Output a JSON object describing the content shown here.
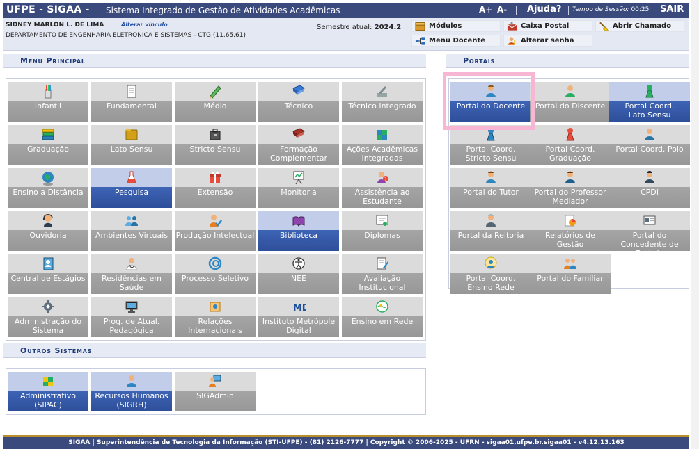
{
  "header": {
    "app_title": "UFPE - SIGAA -",
    "app_subtitle": "Sistema Integrado de Gestão de Atividades Acadêmicas",
    "font_increase": "A+",
    "font_decrease": "A-",
    "help": "Ajuda?",
    "session_label": "Tempo de Sessão:",
    "session_time": "00:25",
    "logout": "SAIR"
  },
  "user": {
    "name": "SIDNEY MARLON L. DE LIMA",
    "change_link": "Alterar vínculo",
    "department": "DEPARTAMENTO DE ENGENHARIA ELETRONICA E SISTEMAS - CTG (11.65.61)",
    "semester_label": "Semestre atual:",
    "semester_value": "2024.2"
  },
  "quick_links": {
    "modulos": "Módulos",
    "caixa_postal": "Caixa Postal",
    "abrir_chamado": "Abrir Chamado",
    "menu_docente": "Menu Docente",
    "alterar_senha": "Alterar senha"
  },
  "sections": {
    "menu_principal": "Menu Principal",
    "portais": "Portais",
    "outros_sistemas": "Outros Sistemas"
  },
  "menu_principal": [
    {
      "label": "Infantil",
      "icon": "pencils-icon",
      "selected": false
    },
    {
      "label": "Fundamental",
      "icon": "notebook-icon",
      "selected": false
    },
    {
      "label": "Médio",
      "icon": "pencil-icon",
      "selected": false
    },
    {
      "label": "Técnico",
      "icon": "blue-book-icon",
      "selected": false
    },
    {
      "label": "Técnico Integrado",
      "icon": "tools-icon",
      "selected": false
    },
    {
      "label": "Graduação",
      "icon": "books-stack-icon",
      "selected": false
    },
    {
      "label": "Lato Sensu",
      "icon": "folder-icon",
      "selected": false
    },
    {
      "label": "Stricto Sensu",
      "icon": "briefcase-icon",
      "selected": false
    },
    {
      "label": "Formação\nComplementar",
      "icon": "red-book-icon",
      "selected": false
    },
    {
      "label": "Ações Acadêmicas\nIntegradas",
      "icon": "puzzle-icon",
      "selected": false
    },
    {
      "label": "Ensino a Distância",
      "icon": "globe-icon",
      "selected": false
    },
    {
      "label": "Pesquisa",
      "icon": "flask-icon",
      "selected": true
    },
    {
      "label": "Extensão",
      "icon": "gift-box-icon",
      "selected": false
    },
    {
      "label": "Monitoria",
      "icon": "presentation-board-icon",
      "selected": false
    },
    {
      "label": "Assistência ao\nEstudante",
      "icon": "student-help-icon",
      "selected": false
    },
    {
      "label": "Ouvidoria",
      "icon": "headset-icon",
      "selected": false
    },
    {
      "label": "Ambientes Virtuais",
      "icon": "virtual-people-icon",
      "selected": false
    },
    {
      "label": "Produção Intelectual",
      "icon": "person-check-icon",
      "selected": false
    },
    {
      "label": "Biblioteca",
      "icon": "open-book-icon",
      "selected": true
    },
    {
      "label": "Diplomas",
      "icon": "certificate-icon",
      "selected": false
    },
    {
      "label": "Central de Estágios",
      "icon": "contacts-book-icon",
      "selected": false
    },
    {
      "label": "Residências em\nSaúde",
      "icon": "doctor-icon",
      "selected": false
    },
    {
      "label": "Processo Seletivo",
      "icon": "spiral-logo-icon",
      "selected": false
    },
    {
      "label": "NEE",
      "icon": "accessibility-icon",
      "selected": false
    },
    {
      "label": "Avaliação\nInstitucional",
      "icon": "evaluation-document-icon",
      "selected": false
    },
    {
      "label": "Administração do\nSistema",
      "icon": "gear-icon",
      "selected": false
    },
    {
      "label": "Prog. de Atual.\nPedagógica",
      "icon": "monitor-icon",
      "selected": false
    },
    {
      "label": "Relações\nInternacionais",
      "icon": "international-map-icon",
      "selected": false
    },
    {
      "label": "Instituto Metrópole\nDigital",
      "icon": "imd-logo-icon",
      "selected": false
    },
    {
      "label": "Ensino em Rede",
      "icon": "network-globe-icon",
      "selected": false
    }
  ],
  "portais": [
    {
      "label": "Portal do Docente",
      "icon": "teacher-icon",
      "selected": true
    },
    {
      "label": "Portal do Discente",
      "icon": "student-green-icon",
      "selected": false
    },
    {
      "label": "Portal Coord.\nLato Sensu",
      "icon": "green-pawn-icon",
      "selected": true
    },
    {
      "label": "Portal Coord.\nStricto Sensu",
      "icon": "blue-pawn-icon",
      "selected": false
    },
    {
      "label": "Portal Coord.\nGraduação",
      "icon": "red-pawn-icon",
      "selected": false
    },
    {
      "label": "Portal Coord. Polo",
      "icon": "coordinator-icon",
      "selected": false
    },
    {
      "label": "Portal do Tutor",
      "icon": "tutor-icon",
      "selected": false
    },
    {
      "label": "Portal do Professor\nMediador",
      "icon": "mediator-icon",
      "selected": false
    },
    {
      "label": "CPDI",
      "icon": "cpdi-person-icon",
      "selected": false
    },
    {
      "label": "Portal da Reitoria",
      "icon": "rector-icon",
      "selected": false
    },
    {
      "label": "Relatórios de\nGestão",
      "icon": "reports-chart-icon",
      "selected": false
    },
    {
      "label": "Portal do\nConcedente de\nEstágio",
      "icon": "id-card-icon",
      "selected": false
    },
    {
      "label": "Portal Coord.\nEnsino Rede",
      "icon": "network-coordinator-icon",
      "selected": false
    },
    {
      "label": "Portal do Familiar",
      "icon": "family-icon",
      "selected": false
    }
  ],
  "outros_sistemas": [
    {
      "label": "Administrativo\n(SIPAC)",
      "icon": "admin-puzzle-icon",
      "selected": true
    },
    {
      "label": "Recursos Humanos\n(SIGRH)",
      "icon": "hr-person-icon",
      "selected": true
    },
    {
      "label": "SIGAdmin",
      "icon": "admin-computer-icon",
      "selected": false
    }
  ],
  "footer": {
    "text": "SIGAA | Superintendência de Tecnologia da Informação (STI-UFPE) - (81) 2126-7777 | Copyright © 2006-2025 - UFRN - sigaa01.ufpe.br.sigaa01 - v4.12.13.163"
  },
  "colors": {
    "header_bg": "#3a4a7c",
    "tile_gray": "#a0a0a0",
    "tile_selected": "#3458a8",
    "highlight": "#f7b6d3",
    "section_title": "#1e3a78"
  }
}
